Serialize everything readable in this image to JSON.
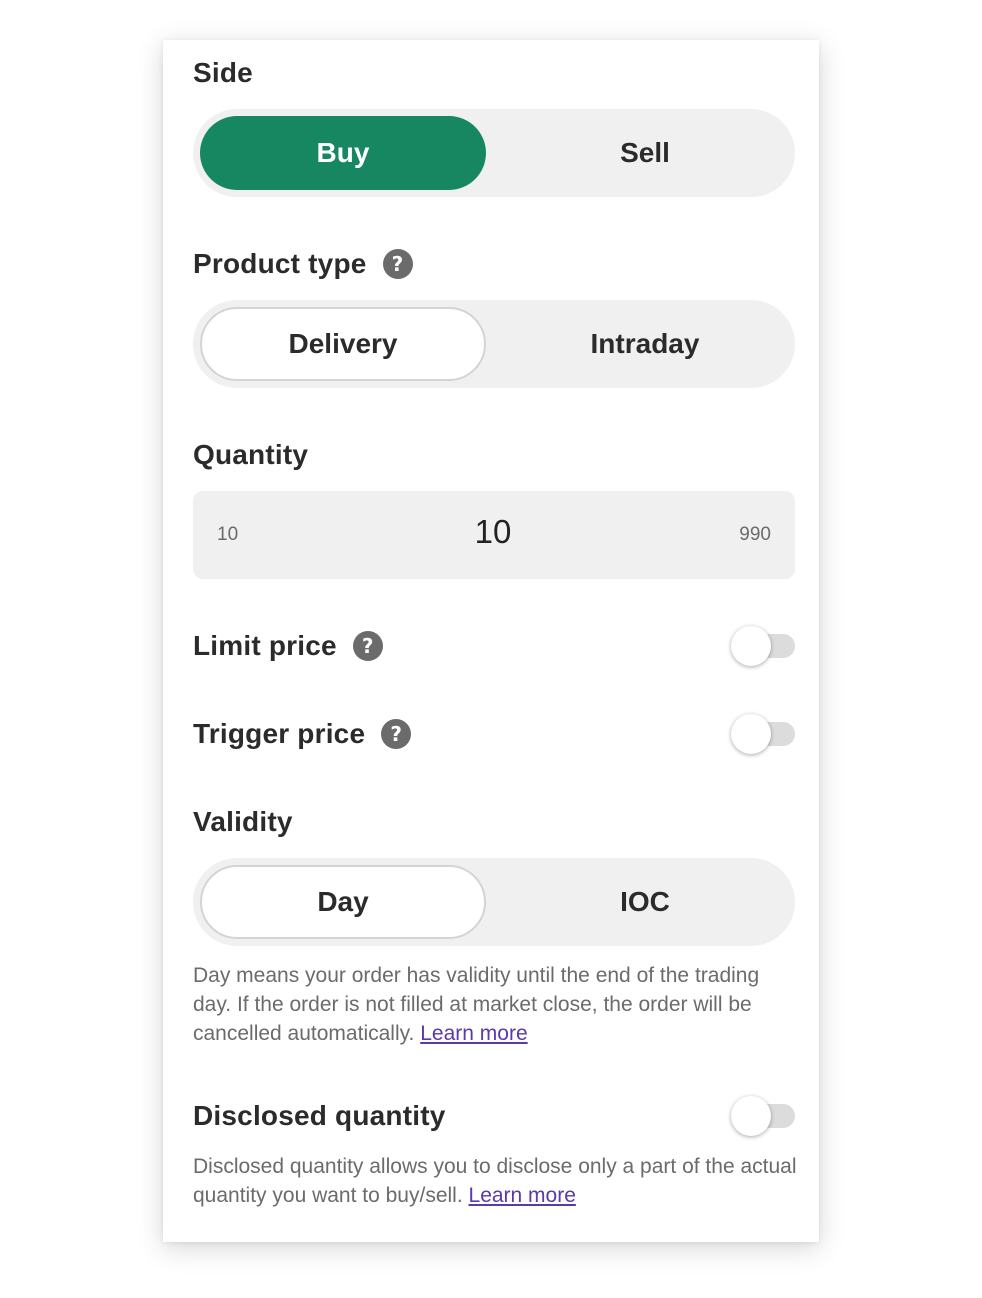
{
  "side": {
    "title": "Side",
    "options": [
      "Buy",
      "Sell"
    ],
    "selected": "Buy",
    "accent_color": "#178762"
  },
  "product_type": {
    "title": "Product type",
    "help_icon": "question-circle-icon",
    "options": [
      "Delivery",
      "Intraday"
    ],
    "selected": "Delivery"
  },
  "quantity": {
    "title": "Quantity",
    "min": "10",
    "value": "10",
    "max": "990"
  },
  "limit_price": {
    "title": "Limit price",
    "help_icon": "question-circle-icon",
    "enabled": false
  },
  "trigger_price": {
    "title": "Trigger price",
    "help_icon": "question-circle-icon",
    "enabled": false
  },
  "validity": {
    "title": "Validity",
    "options": [
      "Day",
      "IOC"
    ],
    "selected": "Day",
    "description": "Day means your order has validity until the end of the trading day. If the order is not filled at market close, the order will be cancelled automatically.",
    "learn_more": "Learn more"
  },
  "disclosed_quantity": {
    "title": "Disclosed quantity",
    "enabled": false,
    "description": "Disclosed quantity allows you to disclose only a part of the actual quantity you want to buy/sell.",
    "learn_more": "Learn more"
  },
  "colors": {
    "link": "#5a3aa8",
    "segment_bg": "#f0f0f0"
  }
}
